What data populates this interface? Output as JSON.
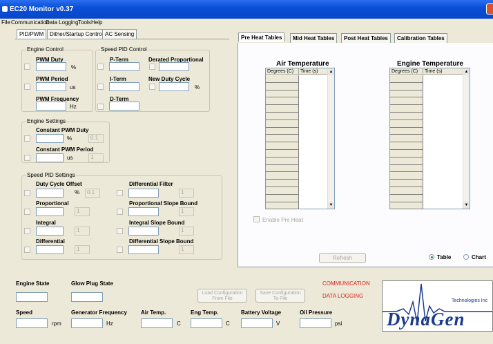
{
  "window": {
    "title": "EC20 Monitor v0.37"
  },
  "menu": [
    "File",
    "Communication",
    "Data Logging",
    "Tools",
    "Help"
  ],
  "left_tabs": [
    "PID/PWM",
    "Dither/Startup Control",
    "AC Sensing"
  ],
  "engine_control": {
    "title": "Engine Control",
    "pwm_duty": "PWM Duty",
    "pwm_duty_unit": "%",
    "pwm_period": "PWM Period",
    "pwm_period_unit": "us",
    "pwm_freq": "PWM Frequency",
    "pwm_freq_unit": "Hz"
  },
  "speed_pid": {
    "title": "Speed PID Control",
    "p_term": "P-Term",
    "i_term": "I-Term",
    "d_term": "D-Term",
    "derated": "Derated Proportional",
    "new_duty": "New Duty Cycle",
    "new_duty_unit": "%"
  },
  "engine_settings": {
    "title": "Engine Settings",
    "const_duty": "Constant PWM Duty",
    "const_duty_unit": "%",
    "const_duty_val": "0.1",
    "const_period": "Constant PWM Period",
    "const_period_unit": "us",
    "const_period_val": "1"
  },
  "pid_settings": {
    "title": "Speed PID Settings",
    "dc_offset": "Duty Cycle Offset",
    "dc_offset_unit": "%",
    "dc_offset_val": "0.1",
    "proportional": "Proportional",
    "integral": "Integral",
    "differential": "Differential",
    "diff_filter": "Differential Filter",
    "prop_slope": "Proportional Slope Bound",
    "int_slope": "Integral Slope Bound",
    "diff_slope": "Differential Slope Bound",
    "one": "1"
  },
  "right_tabs": [
    "Pre Heat Tables",
    "Mid Heat Tables",
    "Post Heat Tables",
    "Calibration Tables"
  ],
  "air_table": {
    "title": "Air Temperature",
    "col1": "Degrees (C)",
    "col2": "Time (s)"
  },
  "engine_table": {
    "title": "Engine Temperature",
    "col1": "Degrees (C)",
    "col2": "Time (s)"
  },
  "enable_preheat": "Enable Pre Heat",
  "refresh": "Refresh",
  "view": {
    "table": "Table",
    "chart": "Chart",
    "selected": "Table"
  },
  "status": {
    "engine_state": "Engine State",
    "glow_plug": "Glow Plug State",
    "communication": "COMMUNICATION",
    "data_logging": "DATA LOGGING",
    "load_line1": "Load Configuration",
    "load_line2": "From File",
    "save_line1": "Save Configuration",
    "save_line2": "To File"
  },
  "bottom": {
    "speed": "Speed",
    "speed_unit": "rpm",
    "gen_freq": "Generator Frequency",
    "gen_unit": "Hz",
    "air_temp": "Air Temp.",
    "air_unit": "C",
    "eng_temp": "Eng Temp.",
    "eng_unit": "C",
    "battery": "Battery Voltage",
    "battery_unit": "V",
    "oil": "Oil Pressure",
    "oil_unit": "psi"
  },
  "logo": {
    "tagline": "Technologies Inc",
    "brand": "DynaGen"
  },
  "colors": {
    "title_bar": "#0a4fd8",
    "status_red": "#e2201a",
    "logo_blue": "#1a3c8c"
  }
}
